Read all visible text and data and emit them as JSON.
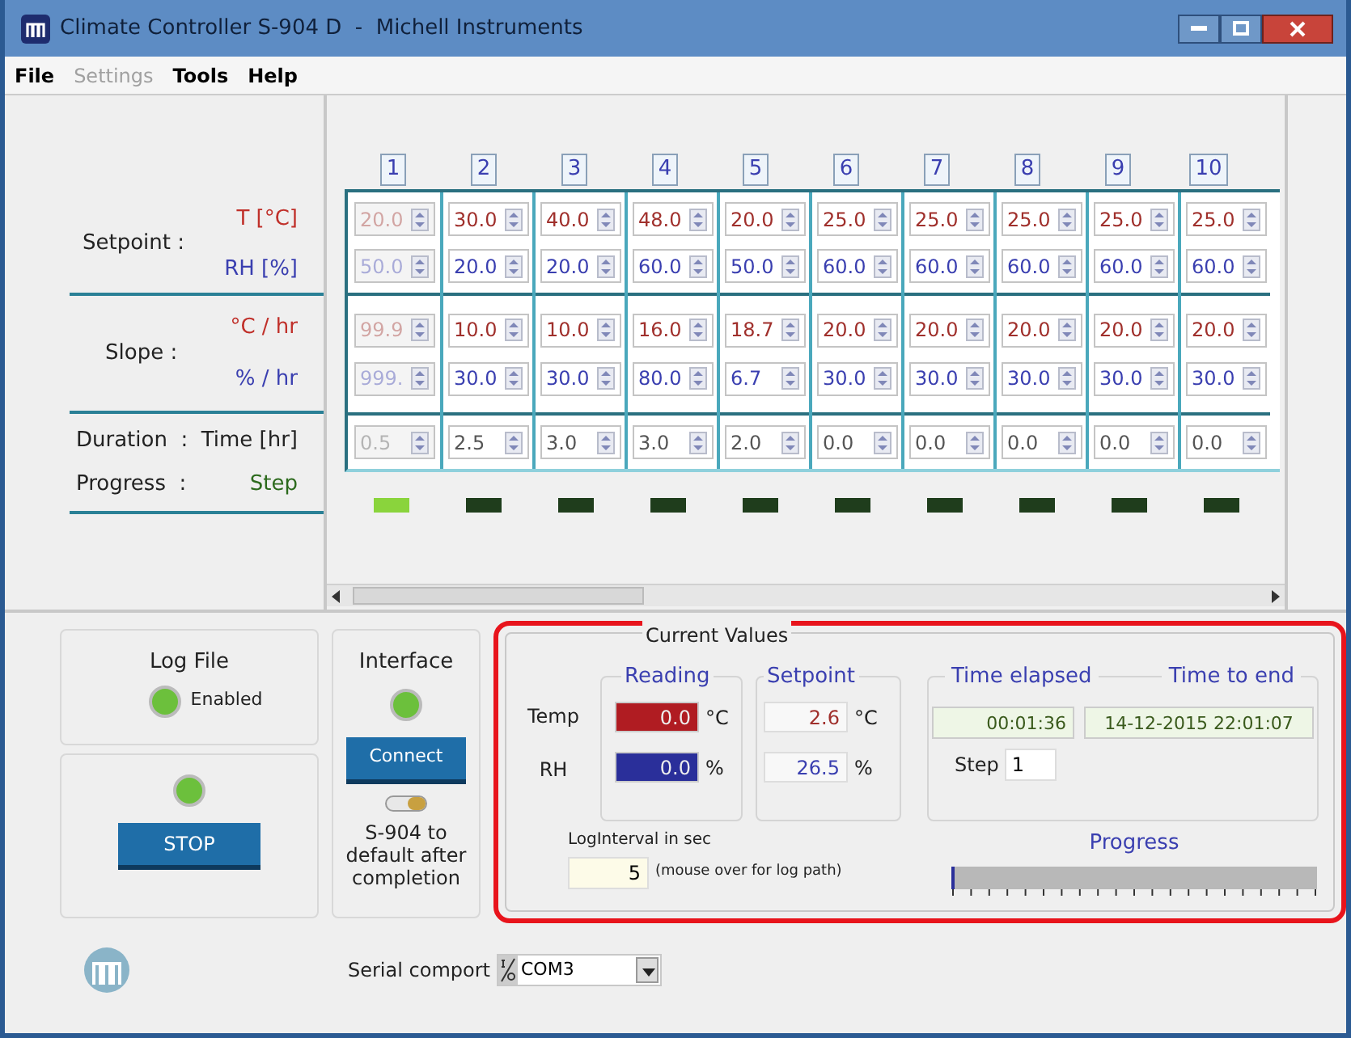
{
  "window": {
    "title": "Climate Controller S-904 D  -  Michell Instruments"
  },
  "menu": [
    {
      "label": "File",
      "disabled": false
    },
    {
      "label": "Settings",
      "disabled": true
    },
    {
      "label": "Tools",
      "disabled": false
    },
    {
      "label": "Help",
      "disabled": false
    }
  ],
  "row_labels": {
    "setpoint": "Setpoint :",
    "setpoint_t": "T [°C]",
    "setpoint_rh": "RH [%]",
    "slope": "Slope :",
    "slope_t": "°C / hr",
    "slope_rh": "% / hr",
    "duration": "Duration  :",
    "duration_unit": "Time [hr]",
    "progress": "Progress  :",
    "progress_unit": "Step"
  },
  "steps": [
    {
      "number": "1",
      "disabled": true,
      "t": "20.0",
      "rh": "50.0",
      "slope_t": "99.9",
      "slope_rh": "999.",
      "time": "0.5",
      "active": true
    },
    {
      "number": "2",
      "disabled": false,
      "t": "30.0",
      "rh": "20.0",
      "slope_t": "10.0",
      "slope_rh": "30.0",
      "time": "2.5",
      "active": false
    },
    {
      "number": "3",
      "disabled": false,
      "t": "40.0",
      "rh": "20.0",
      "slope_t": "10.0",
      "slope_rh": "30.0",
      "time": "3.0",
      "active": false
    },
    {
      "number": "4",
      "disabled": false,
      "t": "48.0",
      "rh": "60.0",
      "slope_t": "16.0",
      "slope_rh": "80.0",
      "time": "3.0",
      "active": false
    },
    {
      "number": "5",
      "disabled": false,
      "t": "20.0",
      "rh": "50.0",
      "slope_t": "18.7",
      "slope_rh": "6.7",
      "time": "2.0",
      "active": false
    },
    {
      "number": "6",
      "disabled": false,
      "t": "25.0",
      "rh": "60.0",
      "slope_t": "20.0",
      "slope_rh": "30.0",
      "time": "0.0",
      "active": false
    },
    {
      "number": "7",
      "disabled": false,
      "t": "25.0",
      "rh": "60.0",
      "slope_t": "20.0",
      "slope_rh": "30.0",
      "time": "0.0",
      "active": false
    },
    {
      "number": "8",
      "disabled": false,
      "t": "25.0",
      "rh": "60.0",
      "slope_t": "20.0",
      "slope_rh": "30.0",
      "time": "0.0",
      "active": false
    },
    {
      "number": "9",
      "disabled": false,
      "t": "25.0",
      "rh": "60.0",
      "slope_t": "20.0",
      "slope_rh": "30.0",
      "time": "0.0",
      "active": false
    },
    {
      "number": "10",
      "disabled": false,
      "t": "25.0",
      "rh": "60.0",
      "slope_t": "20.0",
      "slope_rh": "30.0",
      "time": "0.0",
      "active": false
    }
  ],
  "log_file": {
    "title": "Log File",
    "status": "Enabled",
    "on": true
  },
  "run": {
    "on": true,
    "button": "STOP"
  },
  "interface": {
    "title": "Interface",
    "on": true,
    "button": "Connect",
    "switch_on": true,
    "switch_label": "S-904 to default after completion"
  },
  "current_values": {
    "title": "Current Values",
    "reading_title": "Reading",
    "setpoint_title": "Setpoint",
    "rows": [
      {
        "kind": "temp",
        "label": "Temp",
        "reading": "0.0",
        "reading_unit": "°C",
        "setpoint": "2.6",
        "setpoint_unit": "°C"
      },
      {
        "kind": "rh",
        "label": "RH",
        "reading": "0.0",
        "reading_unit": "%",
        "setpoint": "26.5",
        "setpoint_unit": "%"
      }
    ],
    "time_elapsed_label": "Time elapsed",
    "time_to_end_label": "Time to end",
    "time_elapsed": "00:01:36",
    "time_to_end": "14-12-2015 22:01:07",
    "step_label": "Step",
    "step": "1",
    "log_interval_label": "LogInterval in sec",
    "log_interval": "5",
    "log_hint": "(mouse over for log path)",
    "progress_label": "Progress",
    "progress": {
      "level": 0.01
    }
  },
  "serial": {
    "label": "Serial comport",
    "value": "COM3"
  }
}
